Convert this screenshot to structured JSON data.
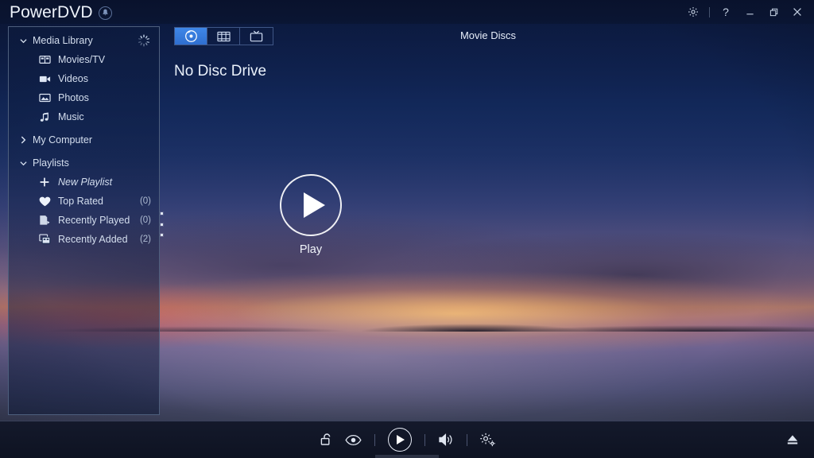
{
  "app": {
    "title": "PowerDVD",
    "badge_icon": "notification-bell-icon"
  },
  "titlebar": {
    "settings_label": "⚙",
    "help_label": "?",
    "minimize_label": "—",
    "restore_label": "❐",
    "close_label": "✕"
  },
  "sidebar": {
    "groups": [
      {
        "label": "Media Library",
        "expanded": true,
        "chevron": "chevron-down-icon",
        "busy": true,
        "items": [
          {
            "label": "Movies/TV",
            "icon": "movies-tv-icon",
            "count": ""
          },
          {
            "label": "Videos",
            "icon": "video-camera-icon",
            "count": ""
          },
          {
            "label": "Photos",
            "icon": "photo-icon",
            "count": ""
          },
          {
            "label": "Music",
            "icon": "music-note-icon",
            "count": ""
          }
        ]
      },
      {
        "label": "My Computer",
        "expanded": false,
        "chevron": "chevron-right-icon",
        "busy": false,
        "items": []
      },
      {
        "label": "Playlists",
        "expanded": true,
        "chevron": "chevron-down-icon",
        "busy": false,
        "items": [
          {
            "label": "New Playlist",
            "icon": "plus-icon",
            "count": "",
            "italic": true
          },
          {
            "label": "Top Rated",
            "icon": "heart-icon",
            "count": "(0)"
          },
          {
            "label": "Recently Played",
            "icon": "recently-played-icon",
            "count": "(0)"
          },
          {
            "label": "Recently Added",
            "icon": "recently-added-icon",
            "count": "(2)"
          }
        ]
      }
    ]
  },
  "content": {
    "tabs": [
      {
        "icon": "disc-icon",
        "active": true
      },
      {
        "icon": "film-strip-icon",
        "active": false
      },
      {
        "icon": "tv-icon",
        "active": false
      }
    ],
    "panel_title": "Movie Discs",
    "status_heading": "No Disc Drive",
    "play_label": "Play"
  },
  "controls": {
    "lock_icon": "unlock-icon",
    "eye_icon": "eye-icon",
    "play_icon": "play-icon",
    "volume_icon": "volume-icon",
    "settings_icon": "gear-icon",
    "eject_icon": "eject-icon"
  },
  "colors": {
    "accent": "#3f87e8",
    "sidebar_border": "#4e5f7d",
    "text_primary": "#eaf1fb",
    "text_secondary": "#aebbd1",
    "ctrlbar_bg": "#14192b"
  }
}
